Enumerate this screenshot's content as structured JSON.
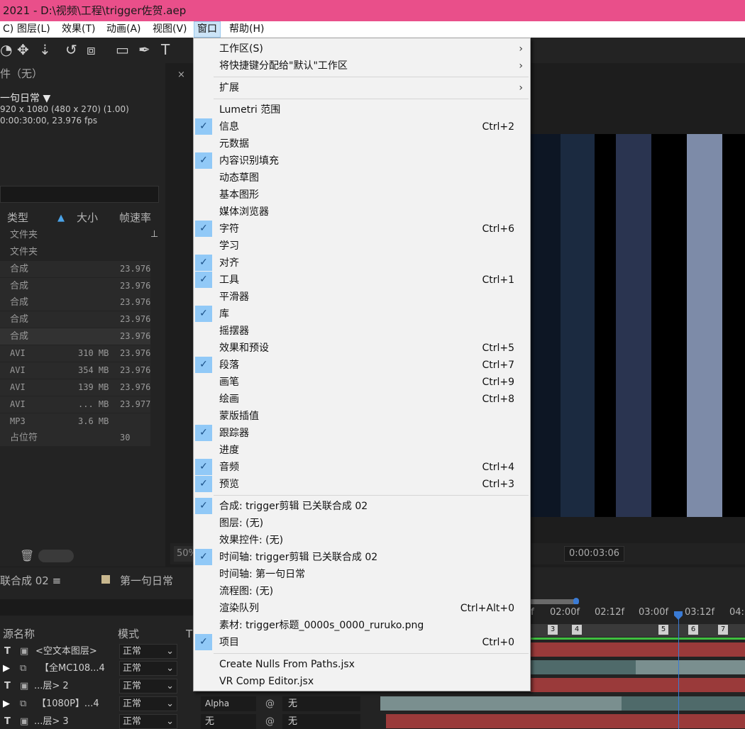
{
  "window": {
    "title": "2021 - D:\\视频\\工程\\trigger佐贺.aep"
  },
  "menubar": [
    {
      "label": "C)"
    },
    {
      "label": "图层(L)"
    },
    {
      "label": "效果(T)"
    },
    {
      "label": "动画(A)"
    },
    {
      "label": "视图(V)"
    },
    {
      "label": "窗口",
      "active": true
    },
    {
      "label": "帮助(H)"
    }
  ],
  "project": {
    "title": "件（无）",
    "comp_name": "一句日常 ▼",
    "info_line1": "920 x 1080  (480 x 270) (1.00)",
    "info_line2": "0:00:30:00, 23.976 fps",
    "columns": {
      "type": "类型",
      "size": "大小",
      "fps": "帧速率"
    },
    "rows": [
      {
        "type": "文件夹",
        "size": "",
        "fps": ""
      },
      {
        "type": "文件夹",
        "size": "",
        "fps": ""
      },
      {
        "type": "合成",
        "size": "",
        "fps": "23.976"
      },
      {
        "type": "合成",
        "size": "",
        "fps": "23.976"
      },
      {
        "type": "合成",
        "size": "",
        "fps": "23.976"
      },
      {
        "type": "合成",
        "size": "",
        "fps": "23.976"
      },
      {
        "type": "合成",
        "size": "",
        "fps": "23.976"
      },
      {
        "type": "AVI",
        "size": "310 MB",
        "fps": "23.976"
      },
      {
        "type": "AVI",
        "size": "354 MB",
        "fps": "23.976"
      },
      {
        "type": "AVI",
        "size": "139 MB",
        "fps": "23.976"
      },
      {
        "type": "AVI",
        "size": "... MB",
        "fps": "23.977"
      },
      {
        "type": "MP3",
        "size": "3.6 MB",
        "fps": ""
      },
      {
        "type": "占位符",
        "size": "",
        "fps": "30"
      }
    ]
  },
  "viewer": {
    "zoom": "50%",
    "timecode": "0:00:03:06"
  },
  "timeline": {
    "tab_active": "联合成 02",
    "tab_other": "第一句日常",
    "col_source": "源名称",
    "col_mode": "模式",
    "col_t": "T",
    "ticks": [
      "f",
      "02:00f",
      "02:12f",
      "03:00f",
      "03:12f",
      "04:"
    ],
    "markers": [
      "3",
      "4",
      "5",
      "6",
      "7"
    ],
    "layers": [
      {
        "type": "T",
        "name": "<空文本图层>",
        "mode": "正常"
      },
      {
        "type": "V",
        "name": "【全MC108...4",
        "mode": "正常"
      },
      {
        "type": "T",
        "name": "...层> 2",
        "mode": "正常"
      },
      {
        "type": "V",
        "name": "【1080P】...4",
        "mode": "正常",
        "trkmat": "Alpha",
        "parent": "无"
      },
      {
        "type": "T",
        "name": "...层> 3",
        "mode": "正常",
        "trkmat": "无",
        "parent": "无"
      }
    ]
  },
  "window_menu": {
    "items": [
      {
        "label": "工作区(S)",
        "shortcut": "",
        "checked": false,
        "submenu": true
      },
      {
        "label": "将快捷键分配给\"默认\"工作区",
        "shortcut": "",
        "checked": false,
        "submenu": true
      },
      {
        "sep": true
      },
      {
        "label": "扩展",
        "shortcut": "",
        "checked": false,
        "submenu": true
      },
      {
        "sep": true
      },
      {
        "label": "Lumetri 范围",
        "shortcut": "",
        "checked": false
      },
      {
        "label": "信息",
        "shortcut": "Ctrl+2",
        "checked": true
      },
      {
        "label": "元数据",
        "shortcut": "",
        "checked": false
      },
      {
        "label": "内容识别填充",
        "shortcut": "",
        "checked": true
      },
      {
        "label": "动态草图",
        "shortcut": "",
        "checked": false
      },
      {
        "label": "基本图形",
        "shortcut": "",
        "checked": false
      },
      {
        "label": "媒体浏览器",
        "shortcut": "",
        "checked": false
      },
      {
        "label": "字符",
        "shortcut": "Ctrl+6",
        "checked": true
      },
      {
        "label": "学习",
        "shortcut": "",
        "checked": false
      },
      {
        "label": "对齐",
        "shortcut": "",
        "checked": true
      },
      {
        "label": "工具",
        "shortcut": "Ctrl+1",
        "checked": true
      },
      {
        "label": "平滑器",
        "shortcut": "",
        "checked": false
      },
      {
        "label": "库",
        "shortcut": "",
        "checked": true
      },
      {
        "label": "摇摆器",
        "shortcut": "",
        "checked": false
      },
      {
        "label": "效果和预设",
        "shortcut": "Ctrl+5",
        "checked": false
      },
      {
        "label": "段落",
        "shortcut": "Ctrl+7",
        "checked": true
      },
      {
        "label": "画笔",
        "shortcut": "Ctrl+9",
        "checked": false
      },
      {
        "label": "绘画",
        "shortcut": "Ctrl+8",
        "checked": false
      },
      {
        "label": "蒙版插值",
        "shortcut": "",
        "checked": false
      },
      {
        "label": "跟踪器",
        "shortcut": "",
        "checked": true
      },
      {
        "label": "进度",
        "shortcut": "",
        "checked": false
      },
      {
        "label": "音频",
        "shortcut": "Ctrl+4",
        "checked": true
      },
      {
        "label": "预览",
        "shortcut": "Ctrl+3",
        "checked": true
      },
      {
        "sep": true
      },
      {
        "label": "合成: trigger剪辑 已关联合成 02",
        "shortcut": "",
        "checked": true
      },
      {
        "label": "图层: (无)",
        "shortcut": "",
        "checked": false
      },
      {
        "label": "效果控件: (无)",
        "shortcut": "",
        "checked": false
      },
      {
        "label": "时间轴: trigger剪辑 已关联合成 02",
        "shortcut": "",
        "checked": true
      },
      {
        "label": "时间轴: 第一句日常",
        "shortcut": "",
        "checked": false
      },
      {
        "label": "流程图: (无)",
        "shortcut": "",
        "checked": false
      },
      {
        "label": "渲染队列",
        "shortcut": "Ctrl+Alt+0",
        "checked": false
      },
      {
        "label": "素材: trigger标题_0000s_0000_ruruko.png",
        "shortcut": "",
        "checked": false
      },
      {
        "label": "项目",
        "shortcut": "Ctrl+0",
        "checked": true
      },
      {
        "sep": true
      },
      {
        "label": "Create Nulls From Paths.jsx",
        "shortcut": "",
        "checked": false
      },
      {
        "label": "VR Comp Editor.jsx",
        "shortcut": "",
        "checked": false
      }
    ]
  }
}
